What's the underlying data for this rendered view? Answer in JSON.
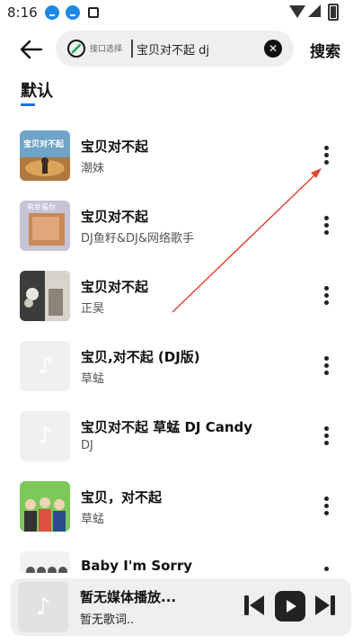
{
  "status_bar": {
    "time": "8:16"
  },
  "search": {
    "interface_label": "接口选择",
    "query": "宝贝对不起 dj",
    "clear_symbol": "✕",
    "submit_label": "搜索"
  },
  "tabs": [
    {
      "label": "默认",
      "active": true
    }
  ],
  "songs": [
    {
      "title": "宝贝对不起",
      "artist": "潮妹",
      "cover": "photo",
      "cover_text": "宝贝对不起"
    },
    {
      "title": "宝贝对不起",
      "artist": "DJ鱼籽&DJ&网络歌手",
      "cover": "photo",
      "cover_text": "有幸看你"
    },
    {
      "title": "宝贝对不起",
      "artist": "正昊",
      "cover": "photo",
      "cover_text": ""
    },
    {
      "title": "宝贝,对不起 (DJ版)",
      "artist": "草蜢",
      "cover": "placeholder",
      "cover_text": ""
    },
    {
      "title": "宝贝对不起 草蜢 DJ Candy",
      "artist": "DJ",
      "cover": "placeholder",
      "cover_text": ""
    },
    {
      "title": "宝贝，对不起",
      "artist": "草蜢",
      "cover": "photo",
      "cover_text": ""
    },
    {
      "title": "Baby I'm Sorry",
      "artist": "",
      "cover": "photo",
      "cover_text": ""
    }
  ],
  "player": {
    "title": "暂无媒体播放...",
    "subtitle": "暂无歌词.."
  },
  "colors": {
    "accent": "#1e6fe0",
    "annotation_arrow": "#e0452e"
  }
}
